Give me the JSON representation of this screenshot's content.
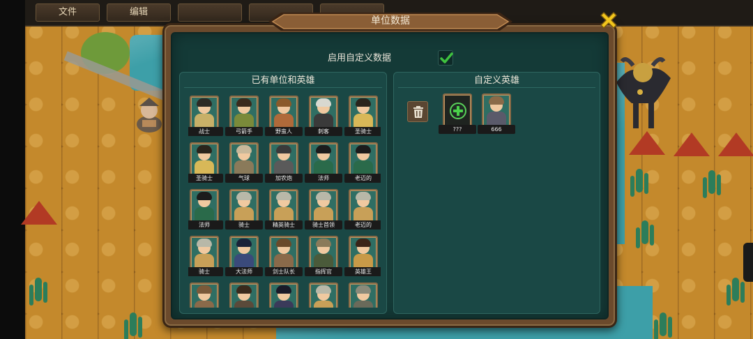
{
  "menu": {
    "items": [
      {
        "label": "文件"
      },
      {
        "label": "编辑"
      },
      {
        "label": ""
      },
      {
        "label": ""
      },
      {
        "label": ""
      }
    ]
  },
  "dialog": {
    "title": "单位数据",
    "enable_custom_label": "启用自定义数据",
    "enable_custom_checked": true,
    "existing_panel": {
      "title": "已有单位和英雄",
      "units": [
        {
          "label": "战士",
          "hair": "#2d2a24",
          "body": "#c8b068"
        },
        {
          "label": "弓箭手",
          "hair": "#3a2a1c",
          "body": "#7a8a3a"
        },
        {
          "label": "野蛮人",
          "hair": "#8a5a2a",
          "body": "#b06a3a"
        },
        {
          "label": "刺客",
          "hair": "#d8d8d0",
          "body": "#3a3a3a"
        },
        {
          "label": "圣骑士",
          "hair": "#2a241c",
          "body": "#d8b858"
        },
        {
          "label": "圣骑士",
          "hair": "#2a241c",
          "body": "#d8b858"
        },
        {
          "label": "气球",
          "hair": "#c8b89a",
          "body": "#8a7a5a"
        },
        {
          "label": "加农炮",
          "hair": "#3a3a3a",
          "body": "#5a5a5a"
        },
        {
          "label": "法师",
          "hair": "#1c1c1c",
          "body": "#2a6a4a"
        },
        {
          "label": "老迈的",
          "hair": "#1c1c1c",
          "body": "#2a6a4a"
        },
        {
          "label": "法师",
          "hair": "#1c1c1c",
          "body": "#2a6a4a"
        },
        {
          "label": "骑士",
          "hair": "#b8b8a8",
          "body": "#c8a058"
        },
        {
          "label": "精英骑士",
          "hair": "#b8b8a8",
          "body": "#c8a058"
        },
        {
          "label": "骑士首领",
          "hair": "#b8b8a8",
          "body": "#c8a058"
        },
        {
          "label": "老迈的",
          "hair": "#b8b8a8",
          "body": "#c8a058"
        },
        {
          "label": "骑士",
          "hair": "#b8b8a8",
          "body": "#c8a058"
        },
        {
          "label": "大法师",
          "hair": "#1a2238",
          "body": "#3a4a7a"
        },
        {
          "label": "剑士队长",
          "hair": "#6a4a2a",
          "body": "#8a6a4a"
        },
        {
          "label": "指挥官",
          "hair": "#8a7a5a",
          "body": "#4a5a3a"
        },
        {
          "label": "英雄王",
          "hair": "#3a2418",
          "body": "#c89a48"
        },
        {
          "label": "",
          "hair": "#7a5a3a",
          "body": "#8a6a4a"
        },
        {
          "label": "",
          "hair": "#3a2a1c",
          "body": "#5a4a3a"
        },
        {
          "label": "",
          "hair": "#1a1a28",
          "body": "#3a3a5a"
        },
        {
          "label": "",
          "hair": "#b8b8a8",
          "body": "#c8a058"
        },
        {
          "label": "",
          "hair": "#8a8a7a",
          "body": "#6a6a5a"
        }
      ]
    },
    "custom_panel": {
      "title": "自定义英雄",
      "heroes": [
        {
          "label": "???",
          "type": "add"
        },
        {
          "label": "666",
          "hair": "#8a6a48",
          "body": "#5a5a6a"
        }
      ]
    }
  },
  "colors": {
    "dialog_bg": "#143a37",
    "panel_bg": "#1a4845",
    "frame_border": "#8a6a46",
    "checkmark": "#3fc23f",
    "close_icon": "#f2c61c"
  }
}
